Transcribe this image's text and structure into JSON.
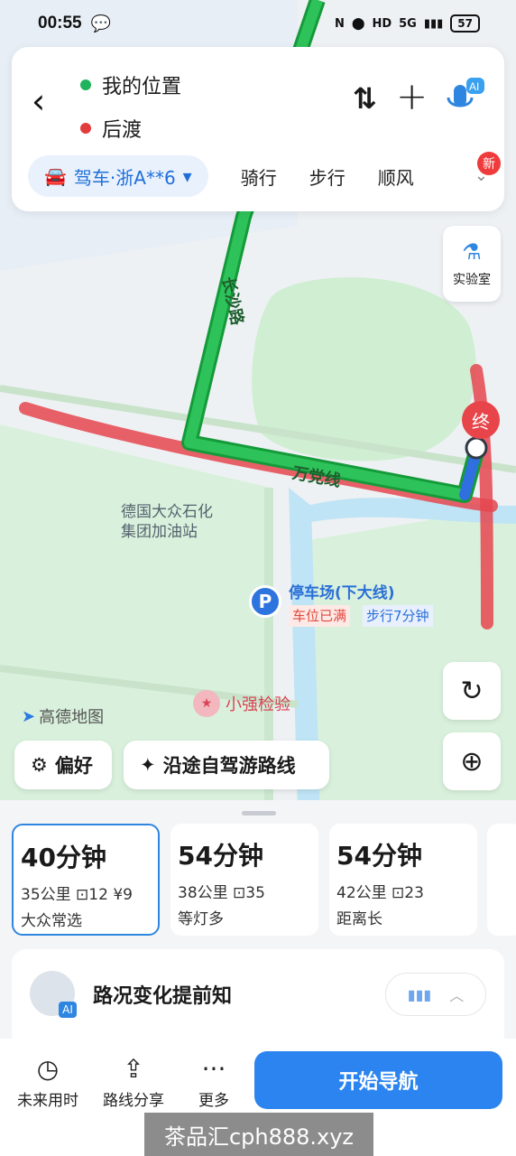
{
  "status_bar": {
    "time": "00:55",
    "network": "5G",
    "battery": "57"
  },
  "route_header": {
    "origin": "我的位置",
    "destination": "后渡",
    "colors": {
      "origin_dot": "#21b35b",
      "destination_dot": "#e23b3b",
      "accent": "#1f6fd9"
    }
  },
  "modes": {
    "drive": "驾车·浙A**6",
    "ride": "骑行",
    "walk": "步行",
    "ride_share": "顺风",
    "new_badge": "新"
  },
  "map": {
    "lab": "实验室",
    "road_name_1": "长沙路",
    "road_name_2": "万党线",
    "gas_station": "德国大众石化\n集团加油站",
    "parking_name": "停车场(下大线)",
    "parking_full": "车位已满",
    "parking_walk": "步行7分钟",
    "end_label": "终",
    "poi": "小强检验",
    "logo": "高德地图",
    "pref_button": "偏好",
    "tour_button": "沿途自驾游路线"
  },
  "routes": [
    {
      "time": "40分钟",
      "distance": "35公里",
      "lights": "12",
      "toll": "9",
      "tag": "大众常选"
    },
    {
      "time": "54分钟",
      "distance": "38公里",
      "lights": "35",
      "tag": "等灯多"
    },
    {
      "time": "54分钟",
      "distance": "42公里",
      "lights": "23",
      "tag": "距离长"
    }
  ],
  "traffic_card": {
    "title": "路况变化提前知",
    "ai": "AI"
  },
  "actions": {
    "future": "未来用时",
    "share": "路线分享",
    "more": "更多",
    "start": "开始导航"
  },
  "watermark": "茶品汇cph888.xyz"
}
